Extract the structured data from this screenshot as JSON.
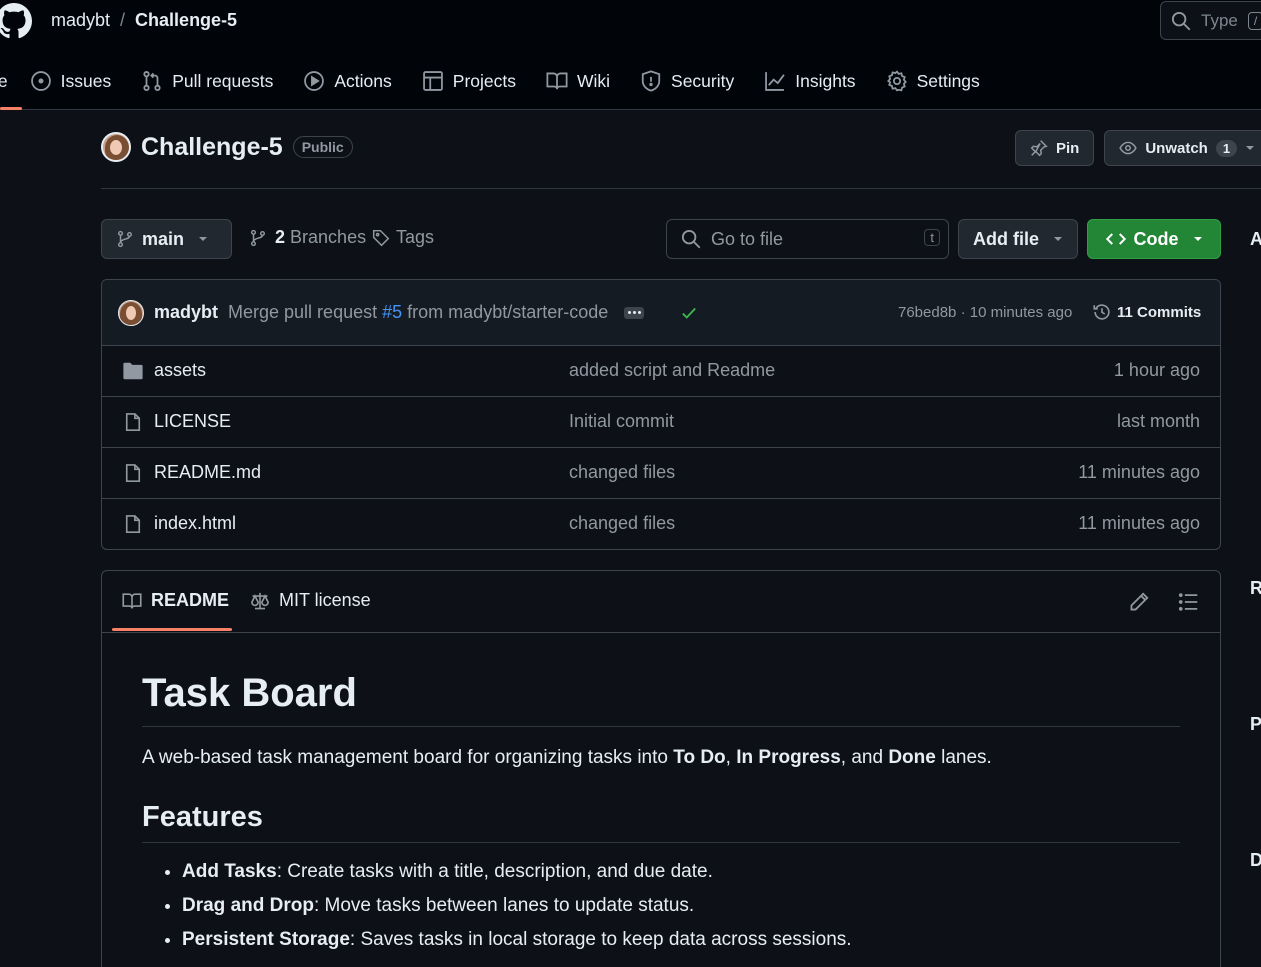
{
  "header": {
    "owner": "madybt",
    "separator": "/",
    "repo": "Challenge-5",
    "search_placeholder": "Type",
    "search_kbd": "/"
  },
  "nav": {
    "code_partial": "le",
    "items": [
      {
        "label": "Issues",
        "icon": "issue-icon"
      },
      {
        "label": "Pull requests",
        "icon": "pull-request-icon"
      },
      {
        "label": "Actions",
        "icon": "play-icon"
      },
      {
        "label": "Projects",
        "icon": "table-icon"
      },
      {
        "label": "Wiki",
        "icon": "book-icon"
      },
      {
        "label": "Security",
        "icon": "shield-icon"
      },
      {
        "label": "Insights",
        "icon": "graph-icon"
      },
      {
        "label": "Settings",
        "icon": "gear-icon"
      }
    ]
  },
  "repo": {
    "name": "Challenge-5",
    "visibility": "Public",
    "pin_label": "Pin",
    "unwatch_label": "Unwatch",
    "watch_count": "1"
  },
  "toolbar": {
    "branch": "main",
    "branches_count": "2",
    "branches_label": "Branches",
    "tags_label": "Tags",
    "goto_placeholder": "Go to file",
    "goto_kbd": "t",
    "add_file": "Add file",
    "code": "Code"
  },
  "commit": {
    "author": "madybt",
    "message_pre": "Merge pull request",
    "pr": "#5",
    "message_post": "from madybt/starter-code",
    "meta": "76bed8b · 10 minutes ago",
    "commits": "11 Commits"
  },
  "files": [
    {
      "name": "assets",
      "type": "folder",
      "message": "added script and Readme",
      "time": "1 hour ago"
    },
    {
      "name": "LICENSE",
      "type": "file",
      "message": "Initial commit",
      "time": "last month"
    },
    {
      "name": "README.md",
      "type": "file",
      "message": "changed files",
      "time": "11 minutes ago"
    },
    {
      "name": "index.html",
      "type": "file",
      "message": "changed files",
      "time": "11 minutes ago"
    }
  ],
  "readme": {
    "tab_readme": "README",
    "tab_license": "MIT license",
    "title": "Task Board",
    "intro_pre": "A web-based task management board for organizing tasks into ",
    "intro_b1": "To Do",
    "intro_sep1": ", ",
    "intro_b2": "In Progress",
    "intro_sep2": ", and ",
    "intro_b3": "Done",
    "intro_post": " lanes.",
    "features_heading": "Features",
    "features": [
      {
        "bold": "Add Tasks",
        "text": ": Create tasks with a title, description, and due date."
      },
      {
        "bold": "Drag and Drop",
        "text": ": Move tasks between lanes to update status."
      },
      {
        "bold": "Persistent Storage",
        "text": ": Saves tasks in local storage to keep data across sessions."
      }
    ]
  },
  "sidebar_partial": {
    "about": "A",
    "releases": "R",
    "packages": "P",
    "deployments": "D"
  }
}
